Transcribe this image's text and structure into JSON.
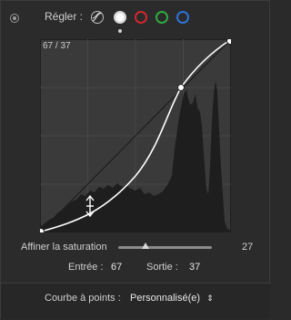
{
  "header": {
    "label": "Régler :"
  },
  "channels": [
    {
      "name": "luminance"
    },
    {
      "name": "white"
    },
    {
      "name": "red"
    },
    {
      "name": "green"
    },
    {
      "name": "blue"
    }
  ],
  "graph": {
    "coords": "67 / 37"
  },
  "saturation": {
    "label": "Affiner la saturation",
    "value": "27",
    "level": 0.27
  },
  "io": {
    "input_label": "Entrée :",
    "input_value": "67",
    "output_label": "Sortie :",
    "output_value": "37"
  },
  "curve_points": {
    "label": "Courbe à points :",
    "selected": "Personnalisé(e)"
  },
  "icons": {
    "panel": "panel-toggle-icon",
    "luminance": "luminance-curve-icon",
    "cursor": "vertical-resize-cursor-icon",
    "select_arrows": "up-down-chevron-icon"
  },
  "colors": {
    "red": "#d0282e",
    "green": "#2faa3f",
    "blue": "#2d73d6"
  }
}
